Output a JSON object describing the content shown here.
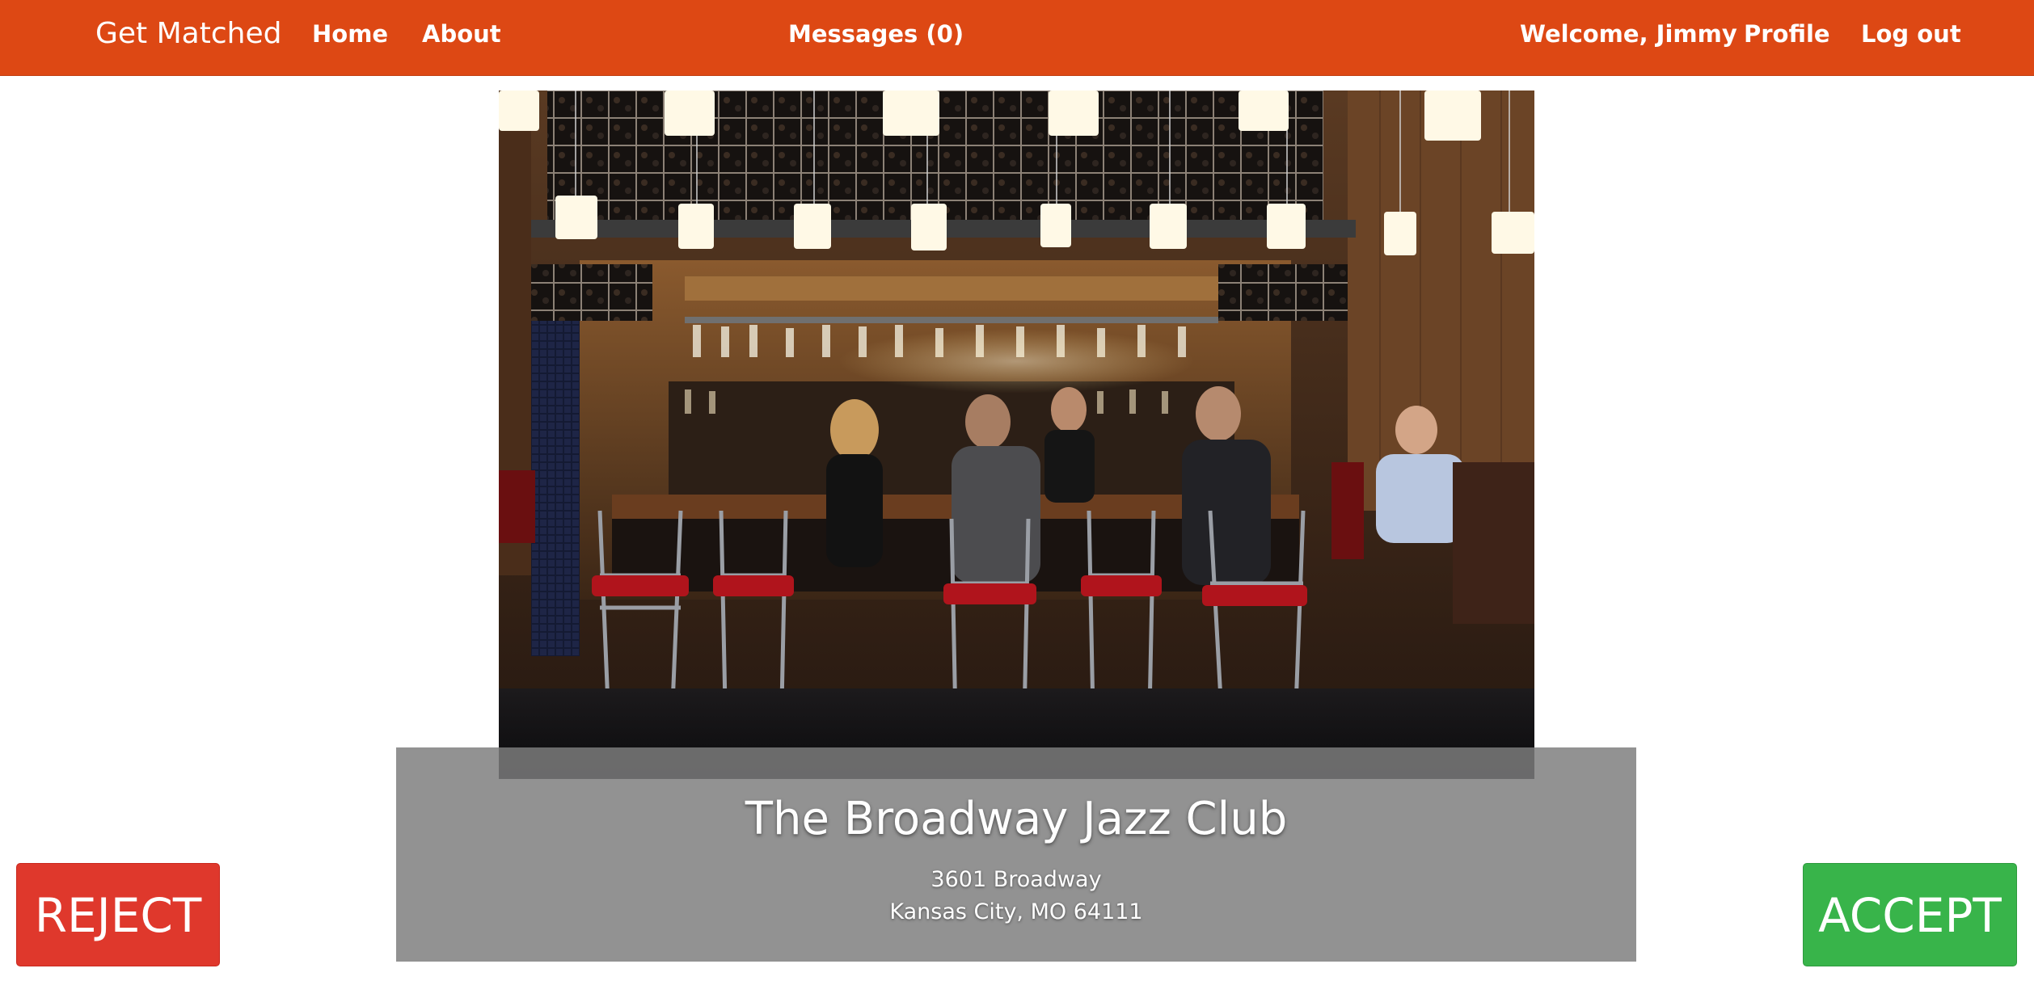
{
  "nav": {
    "brand": "Get Matched",
    "home": "Home",
    "about": "About",
    "messages": "Messages (0)",
    "welcome": "Welcome, Jimmy",
    "profile": "Profile",
    "logout": "Log out"
  },
  "venue": {
    "name": "The Broadway Jazz Club",
    "address_line1": "3601 Broadway",
    "address_line2": "Kansas City, MO 64111"
  },
  "actions": {
    "reject": "REJECT",
    "accept": "ACCEPT"
  },
  "colors": {
    "navbar": "#dd4814",
    "reject": "#df382c",
    "accept": "#38b44a",
    "caption_overlay": "#7d7d7d"
  }
}
